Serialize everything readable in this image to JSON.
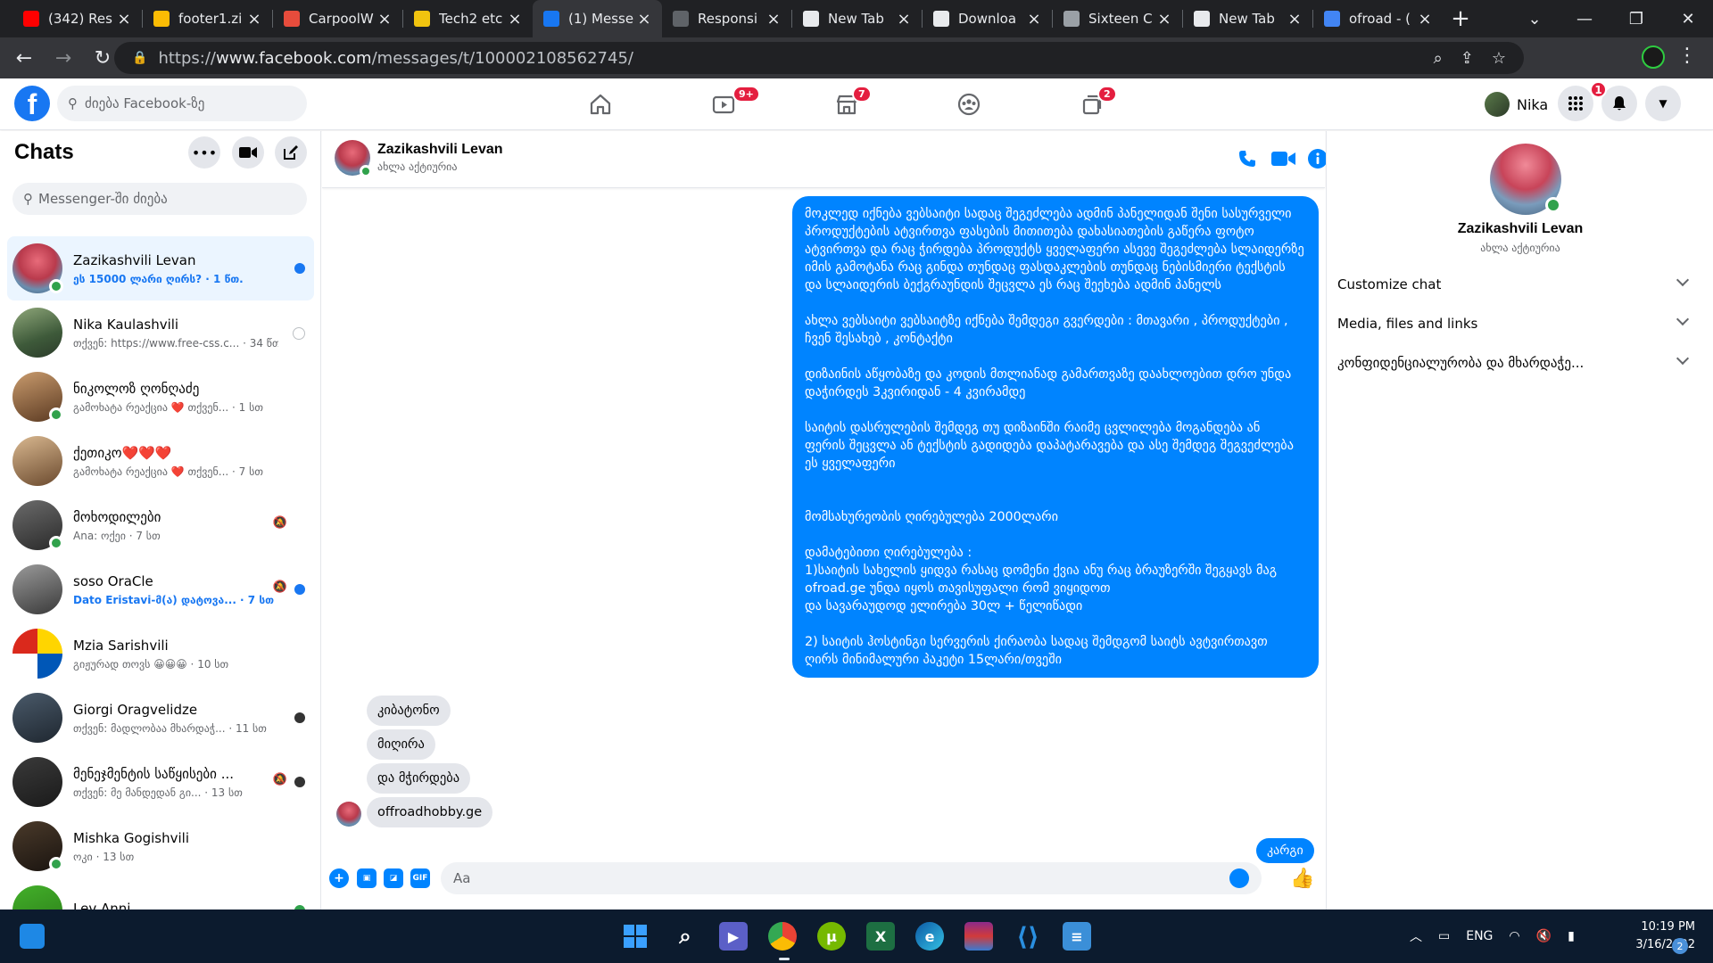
{
  "browser": {
    "tabs": [
      {
        "title": "(342) Res",
        "icon": "youtube-icon",
        "color": "#ff0000"
      },
      {
        "title": "footer1.zi",
        "icon": "google-drive-icon",
        "color": "#fbbc04"
      },
      {
        "title": "CarpoolW",
        "icon": "carpool-icon",
        "color": "#e74c3c"
      },
      {
        "title": "Tech2 etc",
        "icon": "tech2-icon",
        "color": "#f1c40f"
      },
      {
        "title": "(1) Messe",
        "icon": "facebook-icon",
        "color": "#1877f2"
      },
      {
        "title": "Responsi",
        "icon": "responsive-icon",
        "color": "#5f6368"
      },
      {
        "title": "New Tab",
        "icon": "chrome-icon",
        "color": "#e8eaed"
      },
      {
        "title": "Downloa",
        "icon": "download-icon",
        "color": "#e8eaed"
      },
      {
        "title": "Sixteen C",
        "icon": "globe-icon",
        "color": "#9aa0a6"
      },
      {
        "title": "New Tab",
        "icon": "chrome-icon",
        "color": "#e8eaed"
      },
      {
        "title": "ofroad - (",
        "icon": "google-icon",
        "color": "#4285f4"
      }
    ],
    "url_prefix": "https://",
    "url_host": "www.facebook.com",
    "url_path": "/messages/t/100002108562745/"
  },
  "fb": {
    "search_placeholder": "ძიება Facebook-ზე",
    "nav_badges": {
      "watch": "9+",
      "marketplace": "7",
      "gaming": "2"
    },
    "user_name": "Nika",
    "notif_count": "1"
  },
  "chats": {
    "title": "Chats",
    "search_placeholder": "Messenger-ში ძიება",
    "items": [
      {
        "name": "Zazikashvili Levan",
        "sub": "ეს 15000 ლარი ღირს? · 1 წთ.",
        "unread": true,
        "online": true,
        "indicator": "#1877f2",
        "muted": false,
        "av": "radial-gradient(circle at 50% 35%, #e86b7a 0%, #b93a4c 45%, #6a8fb0 70%, #3b5570 100%)"
      },
      {
        "name": "Nika Kaulashvili",
        "sub": "თქვენ: https://www.free-css.c... · 34 წთ",
        "unread": false,
        "online": false,
        "indicator": "seen",
        "muted": false,
        "av": "linear-gradient(160deg,#8fa77a,#3e5a3a 60%,#2b3b2a)"
      },
      {
        "name": "ნიკოლოზ ღონღაძე",
        "sub": "გამოხატა რეაქცია ❤️ თქვენ... · 1 სთ",
        "unread": false,
        "online": true,
        "indicator": "",
        "muted": false,
        "av": "linear-gradient(160deg,#c99b6d,#5b3a22)"
      },
      {
        "name": "ქეთიკო❤️❤️❤️",
        "sub": "გამოხატა რეაქცია ❤️ თქვენ... · 7 სთ",
        "unread": false,
        "online": false,
        "indicator": "",
        "muted": false,
        "av": "linear-gradient(160deg,#d9b890,#6b4a2e)"
      },
      {
        "name": "მოხოდილები",
        "sub": "Ana: ოქეი · 7 სთ",
        "unread": false,
        "online": true,
        "indicator": "",
        "muted": true,
        "av": "linear-gradient(160deg,#6b6b6b,#2a2a2a)"
      },
      {
        "name": "soso OraCle",
        "sub": "Dato Eristavi-მ(ა) დატოვა... · 7 სთ",
        "unread": true,
        "online": false,
        "indicator": "#1877f2",
        "muted": true,
        "av": "linear-gradient(160deg,#9a9a9a,#3a3a3a)"
      },
      {
        "name": "Mzia Sarishvili",
        "sub": "გიჟურად თოვს 😀😀😀 · 10 სთ",
        "unread": false,
        "online": false,
        "indicator": "",
        "muted": false,
        "av": "conic-gradient(#ffd500 0 25%, #0057b7 25% 50%, #ffffff 50% 75%, #da291c 75% 100%)"
      },
      {
        "name": "Giorgi Oragvelidze",
        "sub": "თქვენ: მადლობაა მხარდაჭ... · 11 სთ",
        "unread": false,
        "online": false,
        "indicator": "#333",
        "muted": false,
        "av": "linear-gradient(160deg,#4a5a6a,#1f2730)"
      },
      {
        "name": "მენეჯმენტის საწყისები ...",
        "sub": "თქვენ: მე მანდედან გი... · 13 სთ",
        "unread": false,
        "online": false,
        "indicator": "#333",
        "muted": true,
        "av": "linear-gradient(160deg,#3a3a3a,#1a1a1a)"
      },
      {
        "name": "Mishka Gogishvili",
        "sub": "ოკი · 13 სთ",
        "unread": false,
        "online": true,
        "indicator": "",
        "muted": false,
        "av": "linear-gradient(160deg,#4a3a2a,#1a1410)"
      },
      {
        "name": "Lev Anni",
        "sub": "",
        "unread": false,
        "online": false,
        "indicator": "#31a24c",
        "muted": false,
        "av": "linear-gradient(160deg,#43b02a,#2a7a18)"
      }
    ]
  },
  "conversation": {
    "name": "Zazikashvili Levan",
    "status": "ახლა აქტიურია",
    "outgoing_long": "მოკლედ იქნება ვებსაიტი სადაც შეგეძლება ადმინ პანელიდან შენი სასურველი პროდუქტების ატვირთვა ფასების მითითება დახასიათების გაწერა ფოტო ატვირთვა და რაც ჭირდება პროდუქტს ყველაფერი ასევე შეგეძლება სლაიდერზე იმის გამოტანა რაც გინდა თუნდაც ფასდაკლების თუნდაც ნებისმიერი ტექსტის და სლაიდერის ბექგრაუნდის შეცვლა ეს რაც შეეხება ადმინ პანელს\n\nახლა ვებსაიტი ვებსაიტზე იქნება შემდეგი გვერდები : მთავარი , პროდუქტები , ჩვენ შესახებ , კონტაქტი\n\nდიზაინის აწყობაზე და კოდის მთლიანად გამართვაზე დაახლოებით დრო უნდა დაჭირდეს 3კვირიდან - 4 კვირამდე\n\nსაიტის დასრულების შემდეგ თუ დიზაინში რაიმე ცვლილება მოგანდება ან ფერის შეცვლა ან ტექსტის გადიდება დაპატარავება და ასე შემდეგ შეგვეძლება ეს ყველაფერი\n\n\nმომსახურეობის ღირებულება 2000ლარი\n\nდამატებითი ღირებულება :\n1)საიტის სახელის ყიდვა რასაც დომენი ქვია ანუ რაც ბრაუზერში შეგყავს მაგ ofroad.ge უნდა იყოს თავისუფალი რომ ვიყიდოთ\nდა სავარაუდოდ ელირება 30ლ + წელიწადი\n\n2) საიტის ჰოსტინგი სერვერის ქირაობა სადაც შემდგომ საიტს ავტვირთავთ ღირს მინიმალური პაკეტი 15ლარი/თვეში",
    "incoming": [
      "კიბატონო",
      "მიღირა",
      "და მჭირდება",
      "offroadhobby.ge"
    ],
    "outgoing_partial": "კარგი",
    "composer_placeholder": "Aa"
  },
  "info": {
    "name": "Zazikashvili Levan",
    "status": "ახლა აქტიურია",
    "rows": [
      "Customize chat",
      "Media, files and links",
      "კონფიდენციალურობა და მხარდაჭე..."
    ]
  },
  "taskbar": {
    "lang": "ENG",
    "time": "10:19 PM",
    "date": "3/16/2022",
    "badge": "2"
  }
}
